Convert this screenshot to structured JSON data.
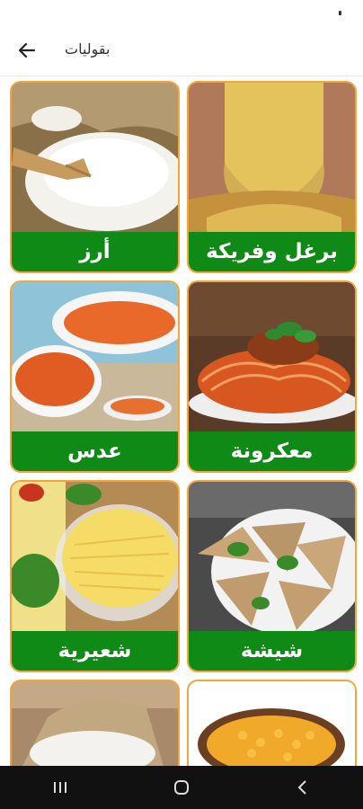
{
  "app_bar": {
    "title": "بقوليات",
    "back_icon": "arrow-left-icon"
  },
  "categories": [
    {
      "label": "أرز",
      "image": "rice-image"
    },
    {
      "label": "برغل وفريكة",
      "image": "bulgur-image"
    },
    {
      "label": "عدس",
      "image": "lentils-image"
    },
    {
      "label": "معكرونة",
      "image": "pasta-image"
    },
    {
      "label": "شعيرية",
      "image": "vermicelli-image"
    },
    {
      "label": "شيشة",
      "image": "dumplings-image"
    },
    {
      "label": "",
      "image": "flour-image"
    },
    {
      "label": "",
      "image": "corn-image"
    }
  ],
  "colors": {
    "accent_border": "#f3a53a",
    "label_bg": "#0f8a17",
    "label_text": "#ffffff",
    "nav_bg": "#111111"
  },
  "nav": {
    "recents_icon": "recents-icon",
    "home_icon": "home-icon",
    "back_icon": "nav-back-icon"
  }
}
